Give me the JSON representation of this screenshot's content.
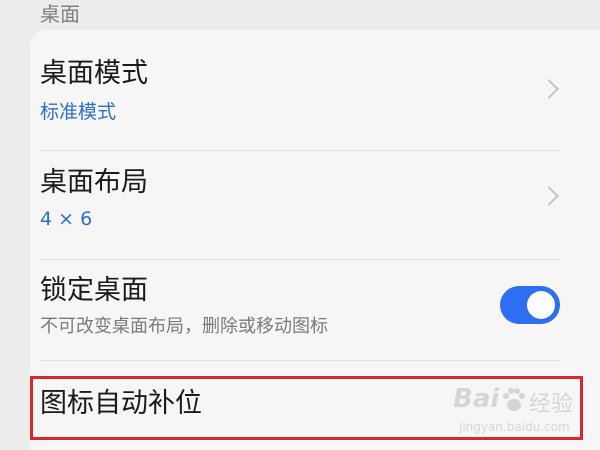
{
  "section": {
    "title": "桌面"
  },
  "rows": {
    "desktop_mode": {
      "title": "桌面模式",
      "value": "标准模式"
    },
    "desktop_layout": {
      "title": "桌面布局",
      "value": "4 × 6"
    },
    "lock_desktop": {
      "title": "锁定桌面",
      "description": "不可改变桌面布局，删除或移动图标",
      "toggle_on": true
    },
    "icon_autofill": {
      "title": "图标自动补位"
    }
  },
  "watermark": {
    "brand": "Bai",
    "brand_suffix": "经验",
    "url": "jingyan.baidu.com"
  },
  "colors": {
    "accent_blue": "#2d6ff0",
    "value_blue": "#2f6fc8",
    "highlight_red": "#d8272e"
  }
}
